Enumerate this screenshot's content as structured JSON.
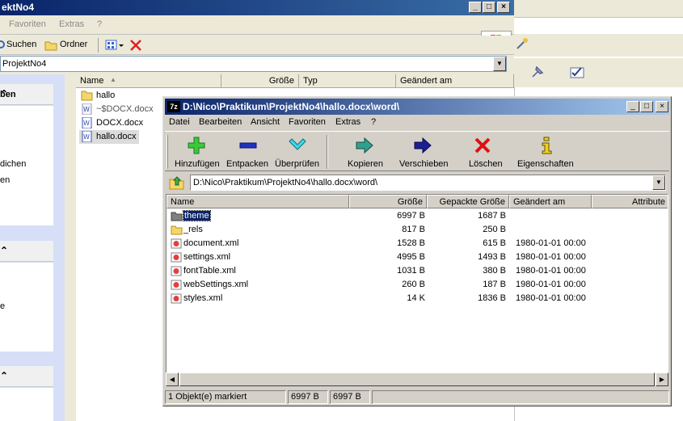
{
  "explorer": {
    "title": "ektNo4",
    "menu": [
      "Favoriten",
      "Extras",
      "?"
    ],
    "toolbar": {
      "search_label": "Suchen",
      "folders_label": "Ordner"
    },
    "address": "ProjektNo4",
    "task_pane": {
      "section1_title": "ben",
      "section1_lines": [
        "dichen",
        "en"
      ],
      "section3_lines": [
        "e"
      ]
    },
    "columns": [
      "Name",
      "Größe",
      "Typ",
      "Geändert am"
    ],
    "files": [
      {
        "name": "hallo",
        "icon": "folder"
      },
      {
        "name": "~$DOCX.docx",
        "icon": "word-doc"
      },
      {
        "name": "DOCX.docx",
        "icon": "word-doc"
      },
      {
        "name": "hallo.docx",
        "icon": "word-doc"
      }
    ]
  },
  "zip": {
    "badge": "7z",
    "title": "D:\\Nico\\Praktikum\\ProjektNo4\\hallo.docx\\word\\",
    "menu": [
      "Datei",
      "Bearbeiten",
      "Ansicht",
      "Favoriten",
      "Extras",
      "?"
    ],
    "toolbar": {
      "add": "Hinzufügen",
      "extract": "Entpacken",
      "test": "Überprüfen",
      "copy": "Kopieren",
      "move": "Verschieben",
      "delete": "Löschen",
      "properties": "Eigenschaften"
    },
    "address": "D:\\Nico\\Praktikum\\ProjektNo4\\hallo.docx\\word\\",
    "columns": {
      "name": "Name",
      "size": "Größe",
      "packed": "Gepackte Größe",
      "modified": "Geändert am",
      "attr": "Attribute"
    },
    "rows": [
      {
        "name": "theme",
        "size": "6997 B",
        "packed": "1687 B",
        "modified": "",
        "icon": "folder-dark"
      },
      {
        "name": "_rels",
        "size": "817 B",
        "packed": "250 B",
        "modified": "",
        "icon": "folder"
      },
      {
        "name": "document.xml",
        "size": "1528 B",
        "packed": "615 B",
        "modified": "1980-01-01 00:00",
        "icon": "xml-file"
      },
      {
        "name": "settings.xml",
        "size": "4995 B",
        "packed": "1493 B",
        "modified": "1980-01-01 00:00",
        "icon": "xml-file"
      },
      {
        "name": "fontTable.xml",
        "size": "1031 B",
        "packed": "380 B",
        "modified": "1980-01-01 00:00",
        "icon": "xml-file"
      },
      {
        "name": "webSettings.xml",
        "size": "260 B",
        "packed": "187 B",
        "modified": "1980-01-01 00:00",
        "icon": "xml-file"
      },
      {
        "name": "styles.xml",
        "size": "14 K",
        "packed": "1836 B",
        "modified": "1980-01-01 00:00",
        "icon": "xml-file"
      }
    ],
    "status": {
      "selected": "1 Objekt(e) markiert",
      "size": "6997 B",
      "packed": "6997 B"
    }
  }
}
